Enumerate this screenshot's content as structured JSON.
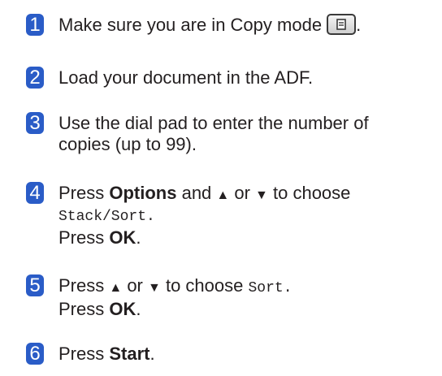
{
  "accent_color": "#2a5cc7",
  "steps": [
    {
      "number": "1",
      "text": "Make sure you are in Copy mode",
      "icon": "copy-mode-key-icon",
      "after_icon": "."
    },
    {
      "number": "2",
      "text": "Load your document in the ADF."
    },
    {
      "number": "3",
      "line1": "Use the dial pad to enter the number of",
      "line2": "copies (up to 99)."
    },
    {
      "number": "4",
      "press": "Press ",
      "options": "Options",
      "and": " and ",
      "up": "▲",
      "or": " or ",
      "down": "▼",
      "to_choose": " to choose",
      "menu_value": "Stack/Sort.",
      "press_ok": "Press ",
      "ok": "OK",
      "period": "."
    },
    {
      "number": "5",
      "press": "Press ",
      "up": "▲",
      "or": " or ",
      "down": "▼",
      "to_choose": " to choose ",
      "menu_value": "Sort.",
      "press_ok": "Press ",
      "ok": "OK",
      "period": "."
    },
    {
      "number": "6",
      "press": "Press ",
      "start": "Start",
      "period": "."
    }
  ]
}
